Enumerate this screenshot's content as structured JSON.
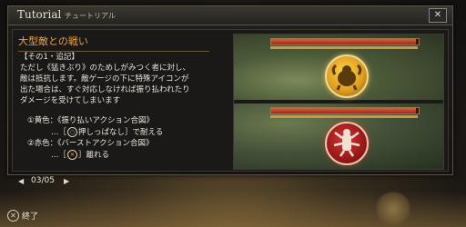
{
  "window": {
    "title": "Tutorial",
    "subtitle": "チュートリアル",
    "close_label": "✕"
  },
  "section": {
    "heading": "大型敵との戦い",
    "body_lines": [
      "【その1・追記】",
      "ただし《猛きぶり》のためしがみつく者に対し、",
      "敵は抵抗します。敵ゲージの下に特殊アイコンが",
      "出た場合は、すぐ対応しなければ振り払われたり",
      "ダメージを受けてしまいます"
    ],
    "hints": {
      "yellow_label": "①黄色：《振り払いアクション合図》",
      "yellow_action_prefix": "…［",
      "yellow_button": "○",
      "yellow_action_suffix": "押しっぱなし］で耐える",
      "red_label": "②赤色：《バーストアクション合図》",
      "red_action_prefix": "…［",
      "red_button": "✕",
      "red_action_suffix": "］離れる"
    }
  },
  "image": {
    "top_gauge_fill": 0.98,
    "bottom_gauge_fill": 0.98,
    "top_icon": "shake-off-icon",
    "bottom_icon": "burst-icon"
  },
  "pager": {
    "prev": "◀",
    "count": "03/05",
    "next": "▶"
  },
  "footer": {
    "exit_button": "✕",
    "exit_label": "終了"
  }
}
